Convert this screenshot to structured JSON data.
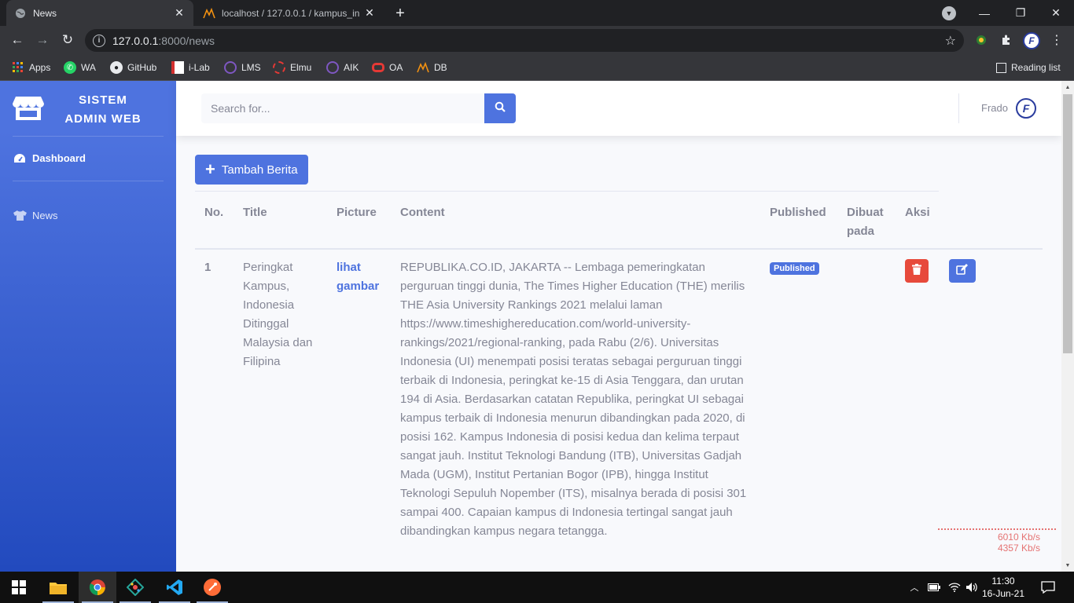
{
  "browser": {
    "tabs": [
      {
        "title": "News",
        "active": true
      },
      {
        "title": "localhost / 127.0.0.1 / kampus_in",
        "active": false
      }
    ],
    "url_host": "127.0.0.1",
    "url_path": ":8000/news",
    "bookmarks": [
      "Apps",
      "WA",
      "GitHub",
      "i-Lab",
      "LMS",
      "Elmu",
      "AIK",
      "OA",
      "DB"
    ],
    "reading_list": "Reading list"
  },
  "sidebar": {
    "brand_line1": "SISTEM",
    "brand_line2": "ADMIN WEB",
    "items": [
      {
        "label": "Dashboard",
        "icon": "tachometer-icon"
      },
      {
        "label": "News",
        "icon": "tshirt-icon"
      }
    ]
  },
  "topbar": {
    "search_placeholder": "Search for...",
    "username": "Frado",
    "avatar_letter": "F"
  },
  "main": {
    "add_button": "Tambah Berita",
    "table": {
      "headers": [
        "No.",
        "Title",
        "Picture",
        "Content",
        "Published",
        "Dibuat pada",
        "Aksi"
      ],
      "rows": [
        {
          "no": "1",
          "title": "Peringkat Kampus, Indonesia Ditinggal Malaysia dan Filipina",
          "picture": "lihat gambar",
          "content": "REPUBLIKA.CO.ID, JAKARTA -- Lembaga pemeringkatan perguruan tinggi dunia, The Times Higher Education (THE) merilis THE Asia University Rankings 2021 melalui laman https://www.timeshighereducation.com/world-university-rankings/2021/regional-ranking, pada Rabu (2/6). Universitas Indonesia (UI) menempati posisi teratas sebagai perguruan tinggi terbaik di Indonesia, peringkat ke-15 di Asia Tenggara, dan urutan 194 di Asia. Berdasarkan catatan Republika, peringkat UI sebagai kampus terbaik di Indonesia menurun dibandingkan pada 2020, di posisi 162. Kampus Indonesia di posisi kedua dan kelima terpaut sangat jauh. Institut Teknologi Bandung (ITB), Universitas Gadjah Mada (UGM), Institut Pertanian Bogor (IPB), hingga Institut Teknologi Sepuluh Nopember (ITS), misalnya berada di posisi 301 sampai 400. Capaian kampus di Indonesia tertingal sangat jauh dibandingkan kampus negara tetangga.",
          "published": "Published",
          "created_at": ""
        }
      ]
    }
  },
  "netmon": {
    "down": "6010 Kb/s",
    "up": "4357 Kb/s"
  },
  "taskbar": {
    "time": "11:30",
    "date": "16-Jun-21"
  },
  "colors": {
    "primary": "#4e73df",
    "danger": "#e74a3b",
    "text": "#858796"
  }
}
